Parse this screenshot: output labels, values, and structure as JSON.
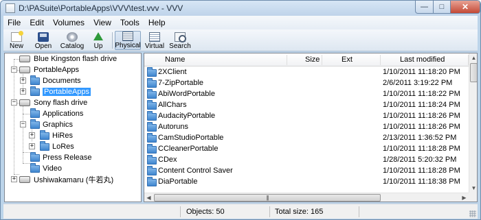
{
  "window": {
    "title": "D:\\PASuite\\PortableApps\\VVV\\test.vvv - VVV",
    "min_glyph": "—",
    "max_glyph": "□",
    "close_glyph": "✕"
  },
  "menu": [
    "File",
    "Edit",
    "Volumes",
    "View",
    "Tools",
    "Help"
  ],
  "toolbar": {
    "new": "New",
    "open": "Open",
    "catalog": "Catalog",
    "up": "Up",
    "physical": "Physical",
    "virtual": "Virtual",
    "search": "Search"
  },
  "tree": {
    "expand": "+",
    "collapse": "−",
    "volumes": {
      "blue_kingston": "Blue Kingston flash drive",
      "portableapps_volume": "PortableApps",
      "documents": "Documents",
      "portableapps_folder": "PortableApps",
      "sony": "Sony flash drive",
      "applications": "Applications",
      "graphics": "Graphics",
      "hires": "HiRes",
      "lores": "LoRes",
      "press_release": "Press Release",
      "video": "Video",
      "ushiwakamaru": "Ushiwakamaru (牛若丸)"
    }
  },
  "list": {
    "columns": {
      "name": "Name",
      "size": "Size",
      "ext": "Ext",
      "modified": "Last modified"
    },
    "rows": [
      {
        "name": "2XClient",
        "modified": "1/10/2011 11:18:20 PM"
      },
      {
        "name": "7-ZipPortable",
        "modified": "2/6/2011 3:19:22 PM"
      },
      {
        "name": "AbiWordPortable",
        "modified": "1/10/2011 11:18:22 PM"
      },
      {
        "name": "AllChars",
        "modified": "1/10/2011 11:18:24 PM"
      },
      {
        "name": "AudacityPortable",
        "modified": "1/10/2011 11:18:26 PM"
      },
      {
        "name": "Autoruns",
        "modified": "1/10/2011 11:18:26 PM"
      },
      {
        "name": "CamStudioPortable",
        "modified": "2/13/2011 1:36:52 PM"
      },
      {
        "name": "CCleanerPortable",
        "modified": "1/10/2011 11:18:28 PM"
      },
      {
        "name": "CDex",
        "modified": "1/28/2011 5:20:32 PM"
      },
      {
        "name": "Content Control Saver",
        "modified": "1/10/2011 11:18:28 PM"
      },
      {
        "name": "DiaPortable",
        "modified": "1/10/2011 11:18:38 PM"
      }
    ],
    "scroll_up": "▲",
    "scroll_down": "▼",
    "scroll_left": "◀",
    "scroll_right": "▶",
    "thumb_grip": "|||"
  },
  "status": {
    "objects": "Objects: 50",
    "total_size": "Total size: 165"
  }
}
